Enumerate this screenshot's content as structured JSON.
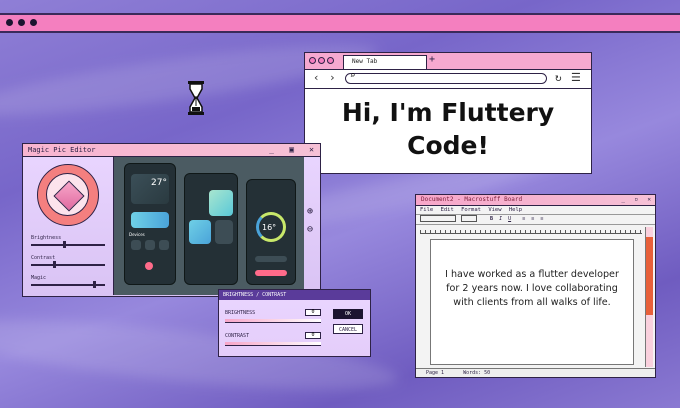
{
  "browser": {
    "tab_label": "New Tab",
    "new_tab_glyph": "+",
    "heading_line1": "Hi, I'm Fluttery",
    "heading_line2": "Code!"
  },
  "editor": {
    "title": "Magic Pic Editor",
    "sliders": [
      {
        "label": "Brightness",
        "value": 0.45
      },
      {
        "label": "Contrast",
        "value": 0.3
      },
      {
        "label": "Magic",
        "value": 0.85
      }
    ],
    "zoom_in_icon": "zoom-in-icon",
    "zoom_out_icon": "zoom-out-icon",
    "mockup": {
      "phone1": {
        "temp": "27°",
        "label": "Devices"
      },
      "phone3": {
        "temp": "16°"
      }
    }
  },
  "dialog": {
    "title": "BRIGHTNESS / CONTRAST",
    "brightness_label": "BRIGHTNESS",
    "brightness_value": "0",
    "contrast_label": "CONTRAST",
    "contrast_value": "0",
    "ok_label": "OK",
    "cancel_label": "CANCEL"
  },
  "document": {
    "title": "Document2 - Macrostuff Board",
    "menu": [
      "File",
      "Edit",
      "Format",
      "View",
      "Help"
    ],
    "body_text": "I have worked as a flutter developer for 2 years now. I love collaborating with clients from all walks of life.",
    "status_page": "Page 1",
    "status_words": "Words: 50"
  },
  "colors": {
    "accent_pink": "#f47fbf",
    "dialog_purple": "#5a3b9a",
    "scroll_orange": "#e8603a"
  }
}
